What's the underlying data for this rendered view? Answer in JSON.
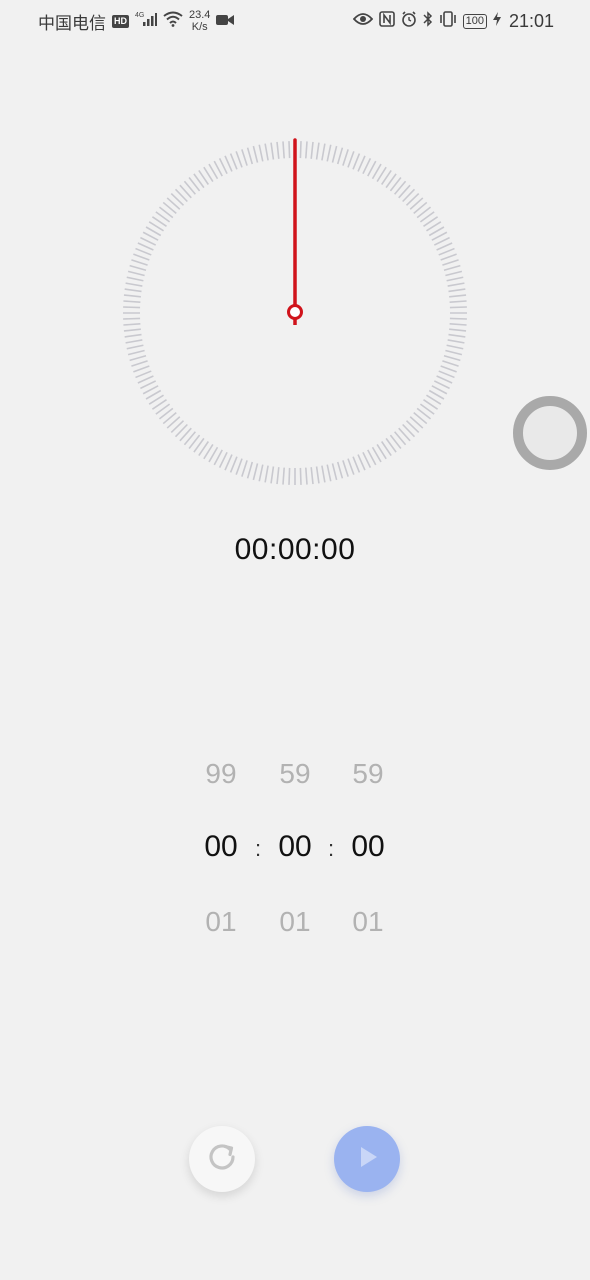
{
  "status_bar": {
    "carrier": "中国电信",
    "hd_badge": "HD",
    "network_type": "4G",
    "speed_value": "23.4",
    "speed_unit": "K/s",
    "battery": "100",
    "time": "21:01",
    "icons": [
      "signal-icon",
      "wifi-icon",
      "video-icon",
      "eye-icon",
      "nfc-icon",
      "alarm-icon",
      "bluetooth-icon",
      "vibrate-icon",
      "battery-icon",
      "charging-icon"
    ]
  },
  "timer": {
    "elapsed": "00:00:00",
    "picker": {
      "hours": {
        "prev": "99",
        "selected": "00",
        "next": "01"
      },
      "minutes": {
        "prev": "59",
        "selected": "00",
        "next": "01"
      },
      "seconds": {
        "prev": "59",
        "selected": "00",
        "next": "01"
      },
      "separator": ":"
    }
  },
  "controls": {
    "reset_icon": "refresh-icon",
    "start_icon": "play-icon"
  },
  "colors": {
    "hand": "#d0131b",
    "ticks": "#c9c9cf",
    "start_button": "#9ab3f0",
    "assist_ball": "#a9a9a9"
  }
}
